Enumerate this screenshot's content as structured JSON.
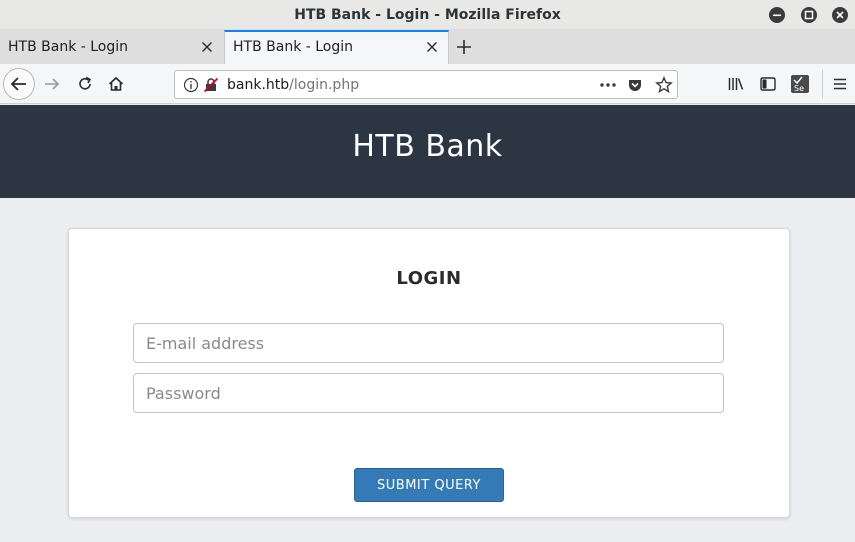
{
  "window": {
    "title": "HTB Bank - Login - Mozilla Firefox"
  },
  "tabs": [
    {
      "label": "HTB Bank - Login",
      "active": false
    },
    {
      "label": "HTB Bank - Login",
      "active": true
    }
  ],
  "navbar": {
    "url_host": "bank.htb",
    "url_path": "/login.php"
  },
  "header": {
    "brand": "HTB Bank"
  },
  "login": {
    "title": "LOGIN",
    "email_placeholder": "E-mail address",
    "password_placeholder": "Password",
    "submit_label": "SUBMIT QUERY"
  },
  "colors": {
    "header_bg": "#2c3642",
    "accent": "#337ab7",
    "tab_highlight": "#0a84ff"
  }
}
